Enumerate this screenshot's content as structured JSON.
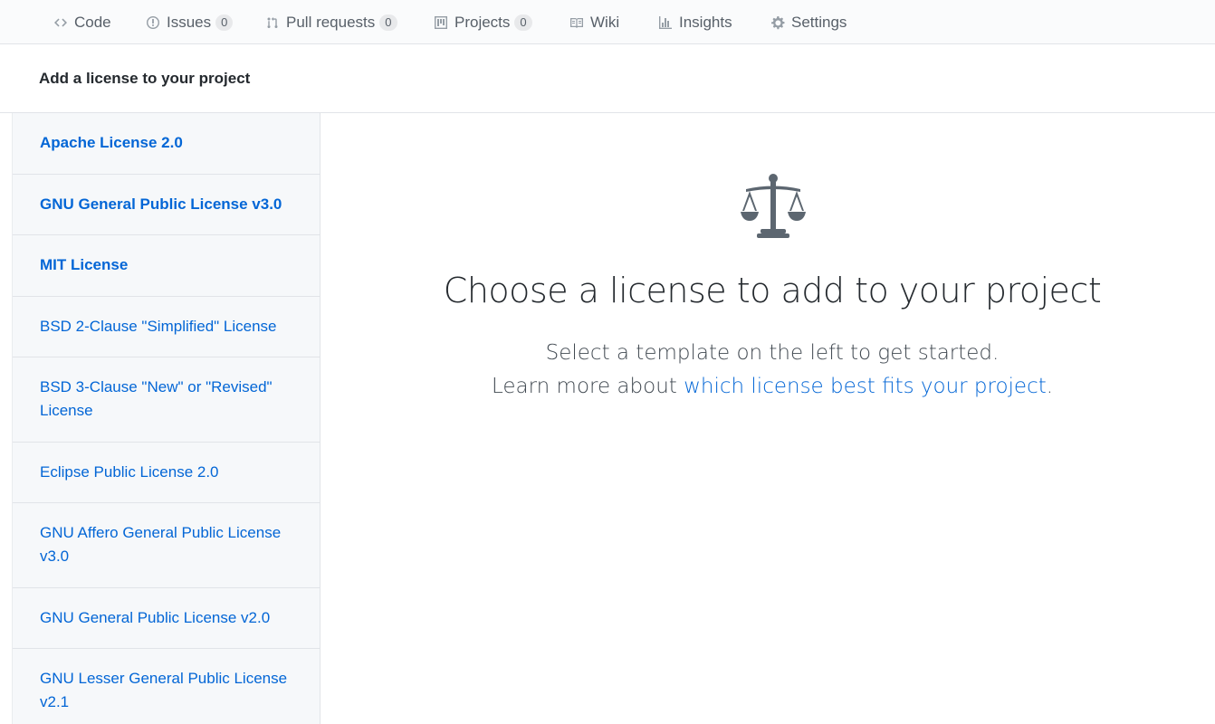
{
  "nav": {
    "tabs": [
      {
        "label": "Code",
        "icon": "code-icon"
      },
      {
        "label": "Issues",
        "icon": "issue-icon",
        "count": "0"
      },
      {
        "label": "Pull requests",
        "icon": "pull-request-icon",
        "count": "0"
      },
      {
        "label": "Projects",
        "icon": "project-icon",
        "count": "0"
      },
      {
        "label": "Wiki",
        "icon": "book-icon"
      },
      {
        "label": "Insights",
        "icon": "graph-icon"
      },
      {
        "label": "Settings",
        "icon": "gear-icon"
      }
    ]
  },
  "header": {
    "title": "Add a license to your project"
  },
  "licenses": [
    "Apache License 2.0",
    "GNU General Public License v3.0",
    "MIT License",
    "BSD 2-Clause \"Simplified\" License",
    "BSD 3-Clause \"New\" or \"Revised\" License",
    "Eclipse Public License 2.0",
    "GNU Affero General Public License v3.0",
    "GNU General Public License v2.0",
    "GNU Lesser General Public License v2.1"
  ],
  "main": {
    "icon": "law-icon",
    "title": "Choose a license to add to your project",
    "line1": "Select a template on the left to get started.",
    "line2_prefix": "Learn more about ",
    "line2_link": "which license best fits your project",
    "line2_suffix": "."
  },
  "colors": {
    "link": "#0366d6",
    "icon": "#5c6670",
    "border": "#e1e4e8"
  }
}
